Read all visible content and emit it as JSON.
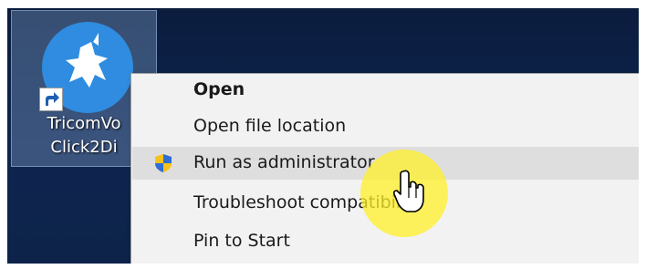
{
  "desktop_icon": {
    "label_line1": "TricomVo",
    "label_line2": "Click2Di",
    "icon": "tricom-app-icon",
    "shortcut_icon": "shortcut-arrow-icon"
  },
  "context_menu": {
    "items": [
      {
        "label": "Open",
        "bold": true
      },
      {
        "label": "Open file location"
      },
      {
        "label": "Run as administrator",
        "icon": "uac-shield-icon",
        "hovered": true
      },
      {
        "label": "Troubleshoot compatibility"
      },
      {
        "label": "Pin to Start"
      }
    ]
  },
  "cursor": {
    "icon": "hand-pointer-icon",
    "highlight_color": "#fff028"
  },
  "colors": {
    "desktop": "#0e2550",
    "menu_bg": "#f2f2f2",
    "hover_bg": "#dedede",
    "app_icon": "#2f8ce0"
  }
}
